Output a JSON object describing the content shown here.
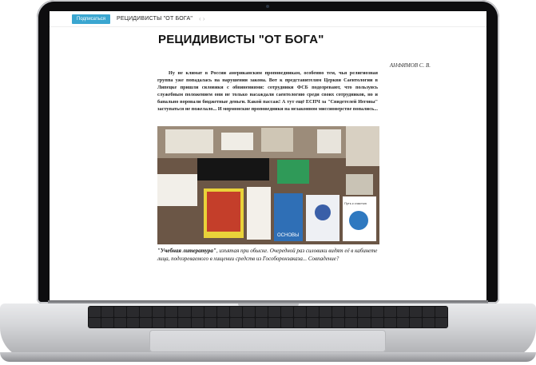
{
  "header": {
    "subscribe_label": "Подписаться",
    "breadcrumb": "РЕЦИДИВИСТЫ \"ОТ БОГА\"",
    "nav_arrows": "‹ ›"
  },
  "article": {
    "title": "РЕЦИДИВИСТЫ \"ОТ БОГА\"",
    "author": "АНФИМОВ С. В.",
    "body": "Ну не климат в России американским проповедникам, особенно тем, чья религиозная группа уже попадалась на нарушении закона. Вот к представителям Церкви Саентологии в Липецке пришли силовики с обвинениями: сотрудники ФСБ подозревают, что пользуясь служебным положением они не только насаждали саентологию среди своих сотрудников, но и банально воровали бюджетные деньги. Какой пассаж! А тут ещё ЕСПЧ за \"Свидетелей Иеговы\" заступаться не пожелало... И мормонские проповедники на незаконном миссионерстве попались...",
    "caption_quoted": "\"Учебная литература\"",
    "caption_rest": ", изъятая при обыске. Очередной раз силовики видят её в кабинете лица, подозреваемого в хищении средств из Гособоронзаказа... Совпадение?"
  },
  "photo": {
    "book_labels": [
      "ОСНОВЫ",
      "Путь к счастью"
    ]
  }
}
